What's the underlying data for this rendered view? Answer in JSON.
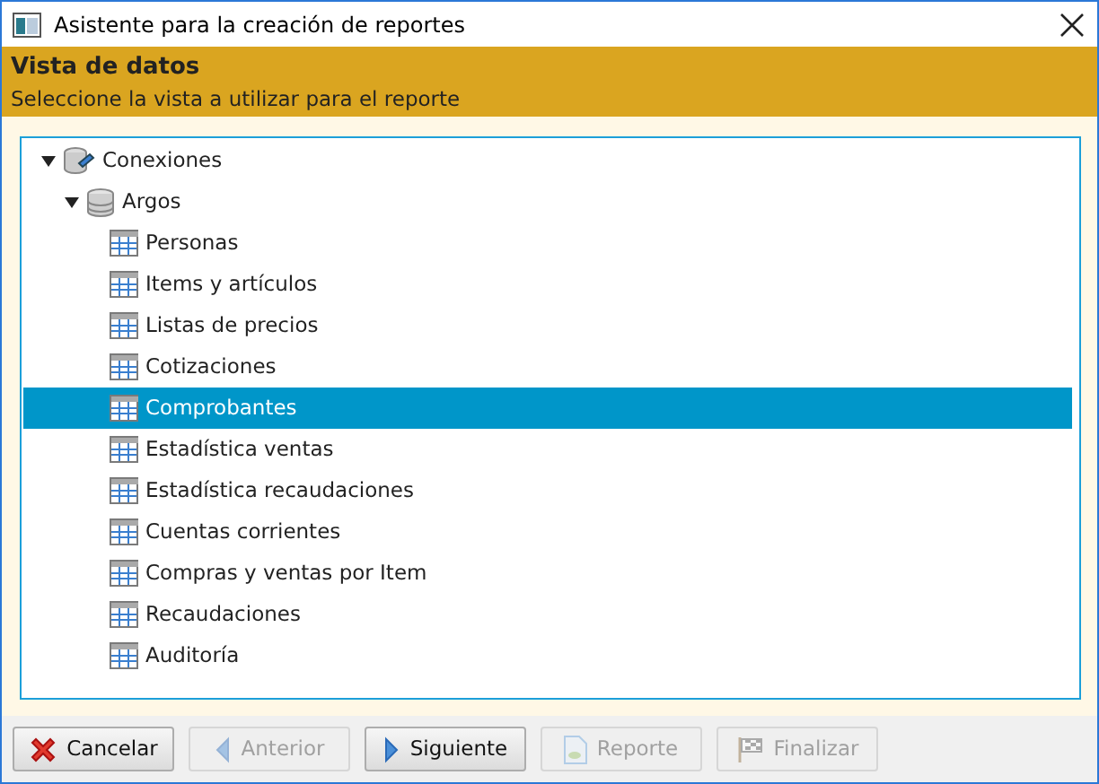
{
  "window": {
    "title": "Asistente para la creación de reportes"
  },
  "header": {
    "title": "Vista de datos",
    "subtitle": "Seleccione la vista a utilizar para el reporte"
  },
  "tree": [
    {
      "label": "Conexiones",
      "kind": "connections",
      "expanded": true,
      "selected": false,
      "children": [
        {
          "label": "Argos",
          "kind": "database",
          "expanded": true,
          "selected": false,
          "children": [
            {
              "label": "Personas",
              "kind": "view",
              "selected": false
            },
            {
              "label": "Items y artículos",
              "kind": "view",
              "selected": false
            },
            {
              "label": "Listas de precios",
              "kind": "view",
              "selected": false
            },
            {
              "label": "Cotizaciones",
              "kind": "view",
              "selected": false
            },
            {
              "label": "Comprobantes",
              "kind": "view",
              "selected": true
            },
            {
              "label": "Estadística ventas",
              "kind": "view",
              "selected": false
            },
            {
              "label": "Estadística recaudaciones",
              "kind": "view",
              "selected": false
            },
            {
              "label": "Cuentas corrientes",
              "kind": "view",
              "selected": false
            },
            {
              "label": "Compras y ventas por Item",
              "kind": "view",
              "selected": false
            },
            {
              "label": "Recaudaciones",
              "kind": "view",
              "selected": false
            },
            {
              "label": "Auditoría",
              "kind": "view",
              "selected": false
            }
          ]
        }
      ]
    }
  ],
  "buttons": [
    {
      "label": "Cancelar",
      "kind": "cancel",
      "disabled": false
    },
    {
      "label": "Anterior",
      "kind": "back",
      "disabled": true
    },
    {
      "label": "Siguiente",
      "kind": "next",
      "disabled": false
    },
    {
      "label": "Reporte",
      "kind": "report",
      "disabled": true
    },
    {
      "label": "Finalizar",
      "kind": "finish",
      "disabled": true
    }
  ]
}
